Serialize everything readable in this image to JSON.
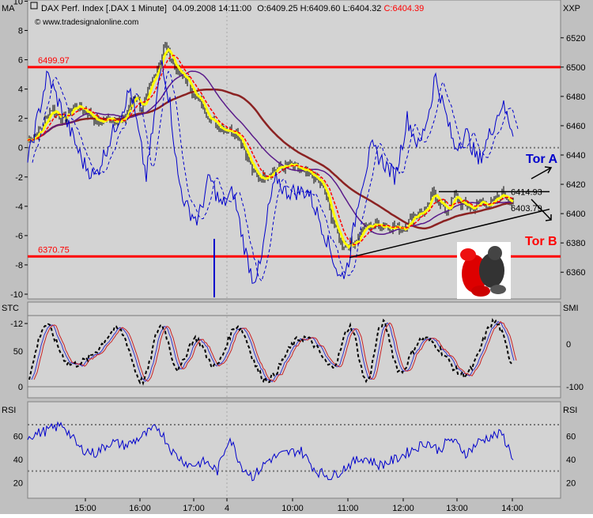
{
  "header": {
    "instrument": "DAX Perf. Index [.DAX  1 Minute]",
    "datetime": "04.09.2008 14:11:00",
    "open": "O:6409.25",
    "high": "H:6409.60",
    "low": "L:6404.32",
    "close": "C:6404.39",
    "source": "www.tradesignalonline.com",
    "left_axis_label": "MA",
    "right_axis_label": "XXP"
  },
  "colors": {
    "background": "#c0c0c0",
    "plot_bg": "#d3d3d3",
    "support_resistance": "#ff0000",
    "close_label": "#ff0000",
    "ma_fast": "#ffff00",
    "ma_red": "#ff0000",
    "ma_purple": "#5a1a8a",
    "ma_slow": "#8b2222",
    "osc_blue": "#0000cc",
    "annotation_blue": "#0000cc",
    "annotation_red": "#ff0000"
  },
  "chart_data": [
    {
      "type": "line",
      "panel": "price",
      "y_left_ticks": [
        10,
        8,
        6,
        4,
        2,
        0,
        -2,
        -4,
        -6,
        -8,
        -10,
        -12
      ],
      "y_right_ticks": [
        6520,
        6500,
        6480,
        6460,
        6440,
        6420,
        6400,
        6380,
        6360
      ],
      "ylim_right": [
        6345,
        6535
      ],
      "x_tick_labels": [
        "15:00",
        "16:00",
        "17:00",
        "4",
        "10:00",
        "11:00",
        "12:00",
        "13:00",
        "14:00"
      ],
      "levels": [
        {
          "label": "6499.97",
          "value": 6499.97
        },
        {
          "label": "6370.75",
          "value": 6370.75
        }
      ],
      "triangle_labels": [
        "6414.93",
        "6403.79"
      ],
      "annotations": [
        "Tor A",
        "Tor B"
      ],
      "close_series": [
        [
          "15:00",
          6452
        ],
        [
          "15:30",
          6478
        ],
        [
          "16:00",
          6476
        ],
        [
          "16:30",
          6520
        ],
        [
          "17:00",
          6490
        ],
        [
          "17:30",
          6462
        ],
        [
          "4",
          6428
        ],
        [
          "10:00",
          6430
        ],
        [
          "10:30",
          6396
        ],
        [
          "11:00",
          6385
        ],
        [
          "11:30",
          6393
        ],
        [
          "12:00",
          6392
        ],
        [
          "12:30",
          6412
        ],
        [
          "13:00",
          6404
        ],
        [
          "13:30",
          6408
        ],
        [
          "14:00",
          6404.39
        ]
      ]
    },
    {
      "type": "line",
      "panel": "stochastic",
      "label": "STC",
      "right_label": "SMI",
      "y_left_ticks": [
        50,
        0
      ],
      "y_right_ticks": [
        0,
        -100
      ],
      "ylim": [
        -10,
        110
      ]
    },
    {
      "type": "line",
      "panel": "rsi",
      "label": "RSI",
      "right_label": "RSI",
      "y_left_ticks": [
        60,
        40,
        20
      ],
      "y_right_ticks": [
        60,
        40,
        20
      ],
      "ylim": [
        10,
        85
      ],
      "reference_levels": [
        70,
        30
      ]
    }
  ]
}
